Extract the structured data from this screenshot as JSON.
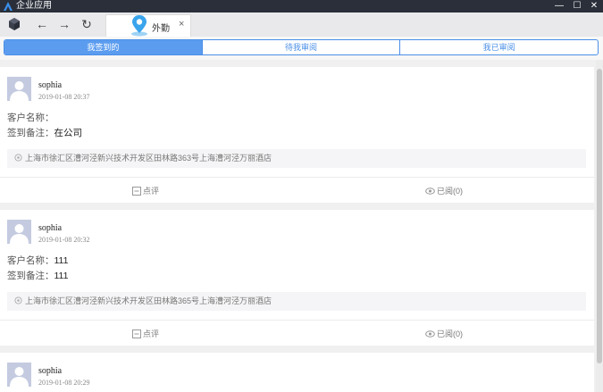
{
  "window": {
    "title": "企业应用",
    "minimize": "—",
    "maximize": "☐",
    "close": "✕"
  },
  "toolbar": {
    "back": "←",
    "forward": "→",
    "refresh": "↻"
  },
  "tab": {
    "label": "外勤",
    "close": "×"
  },
  "segments": [
    {
      "label": "我签到的",
      "active": true
    },
    {
      "label": "待我审阅",
      "active": false
    },
    {
      "label": "我已审阅",
      "active": false
    }
  ],
  "fields": {
    "customer_label": "客户名称：",
    "note_label": "签到备注："
  },
  "actions": {
    "comment_label": "点评",
    "read_label": "已阅(0)"
  },
  "records": [
    {
      "name": "sophia",
      "time": "2019-01-08 20:37",
      "customer": "",
      "note": "在公司",
      "address": "上海市徐汇区漕河泾新兴技术开发区田林路363号上海漕河泾万丽酒店"
    },
    {
      "name": "sophia",
      "time": "2019-01-08 20:32",
      "customer": "111",
      "note": "111",
      "address": "上海市徐汇区漕河泾新兴技术开发区田林路365号上海漕河泾万丽酒店"
    },
    {
      "name": "sophia",
      "time": "2019-01-08 20:29",
      "customer": "",
      "note": "",
      "address": ""
    }
  ]
}
